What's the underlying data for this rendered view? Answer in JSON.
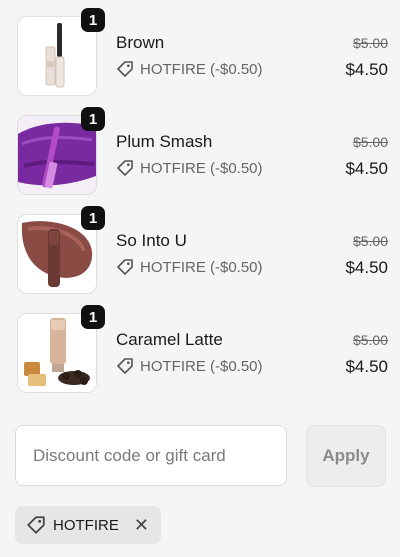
{
  "items": [
    {
      "name": "Brown",
      "discount": "HOTFIRE (-$0.50)",
      "original_price": "$5.00",
      "price": "$4.50",
      "quantity": "1",
      "image": "mascara-tube"
    },
    {
      "name": "Plum Smash",
      "discount": "HOTFIRE (-$0.50)",
      "original_price": "$5.00",
      "price": "$4.50",
      "quantity": "1",
      "image": "plum-eyeliner-swatch"
    },
    {
      "name": "So Into U",
      "discount": "HOTFIRE (-$0.50)",
      "original_price": "$5.00",
      "price": "$4.50",
      "quantity": "1",
      "image": "lip-crayon-swatch"
    },
    {
      "name": "Caramel Latte",
      "discount": "HOTFIRE (-$0.50)",
      "original_price": "$5.00",
      "price": "$4.50",
      "quantity": "1",
      "image": "tube-with-caramels"
    }
  ],
  "discount_input": {
    "placeholder": "Discount code or gift card",
    "value": ""
  },
  "apply_label": "Apply",
  "applied_code": {
    "label": "HOTFIRE"
  },
  "icons": {
    "discount_tag": "tag-icon",
    "remove": "close-icon"
  }
}
